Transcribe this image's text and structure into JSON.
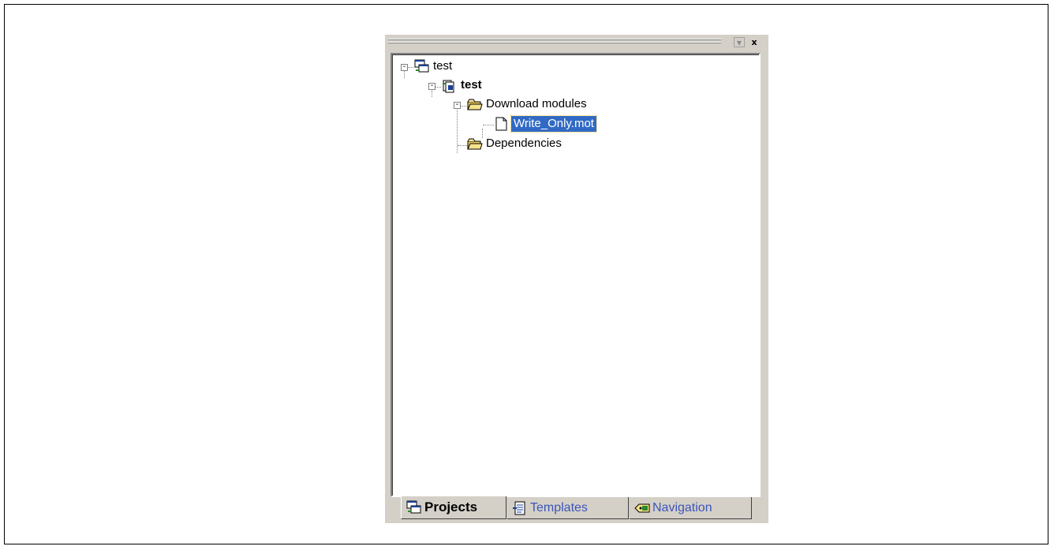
{
  "panel": {
    "title_buttons": {
      "dropdown_icon": "chevron-down-icon",
      "close_label": "x"
    }
  },
  "tree": {
    "nodes": [
      {
        "label": "test",
        "icon": "workspace-icon",
        "expanded": true,
        "bold": false
      },
      {
        "label": "test",
        "icon": "project-icon",
        "expanded": true,
        "bold": true
      },
      {
        "label": "Download modules",
        "icon": "folder-icon",
        "expanded": true,
        "bold": false
      },
      {
        "label": "Write_Only.mot",
        "icon": "file-icon",
        "selected": true
      },
      {
        "label": "Dependencies",
        "icon": "folder-icon",
        "bold": false
      }
    ]
  },
  "tabs": [
    {
      "label": "Projects",
      "icon": "projects-icon",
      "active": true
    },
    {
      "label": "Templates",
      "icon": "templates-icon",
      "active": false
    },
    {
      "label": "Navigation",
      "icon": "navigation-icon",
      "active": false
    }
  ],
  "colors": {
    "selection": "#316ac5",
    "panel_bg": "#d4d0c8",
    "inactive_tab_text": "#3c55b8"
  }
}
